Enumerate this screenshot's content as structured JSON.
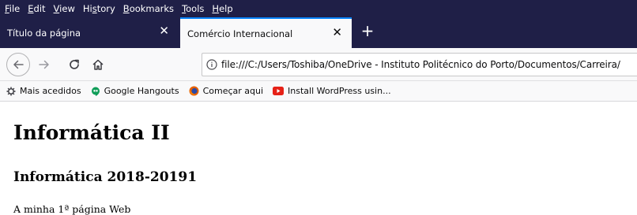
{
  "menu": {
    "items": [
      {
        "accel": "F",
        "rest": "ile"
      },
      {
        "accel": "E",
        "rest": "dit"
      },
      {
        "accel": "V",
        "rest": "iew"
      },
      {
        "pre": "Hi",
        "accel": "s",
        "rest": "tory"
      },
      {
        "accel": "B",
        "rest": "ookmarks"
      },
      {
        "accel": "T",
        "rest": "ools"
      },
      {
        "accel": "H",
        "rest": "elp"
      }
    ]
  },
  "tabs": [
    {
      "title": "Título da página",
      "active": false
    },
    {
      "title": "Comércio Internacional",
      "active": true
    }
  ],
  "toolbar": {
    "url": "file:///C:/Users/Toshiba/OneDrive - Instituto Politécnico do Porto/Documentos/Carreira/"
  },
  "bookmarks": [
    {
      "label": "Mais acedidos",
      "icon": "gear-icon"
    },
    {
      "label": "Google Hangouts",
      "icon": "hangouts-icon",
      "color": "#0f9d58"
    },
    {
      "label": "Começar aqui",
      "icon": "firefox-icon",
      "color": "#e66000"
    },
    {
      "label": "Install WordPress usin...",
      "icon": "youtube-icon",
      "color": "#e62117"
    }
  ],
  "page": {
    "h1": "Informática II",
    "h2": "Informática 2018-20191",
    "paragraph": "A minha 1ª página Web"
  },
  "colors": {
    "titlebar": "#1f1f47",
    "active_tab_accent": "#0a84ff",
    "toolbar_bg": "#f9f9fa"
  }
}
